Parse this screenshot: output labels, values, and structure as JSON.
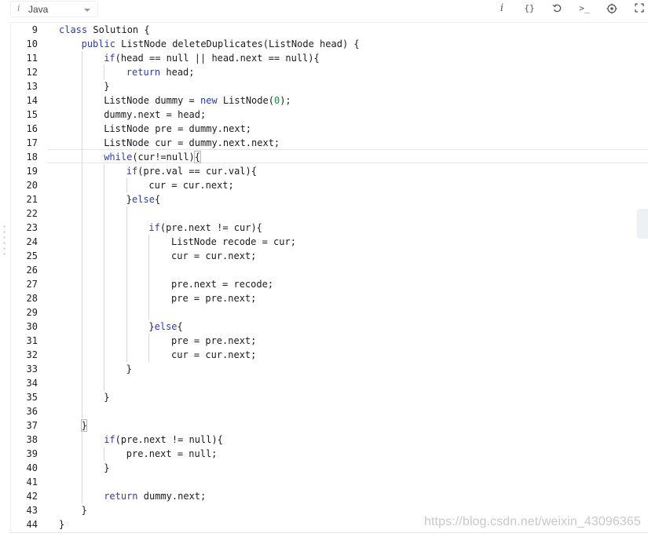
{
  "toolbar": {
    "language": "Java",
    "info_glyph": "i",
    "icons": [
      "info-icon",
      "braces-icon",
      "reset-icon",
      "console-icon",
      "settings-icon",
      "fullscreen-icon"
    ],
    "icon_glyphs": {
      "info": "i",
      "braces": "{}",
      "console": ">_"
    }
  },
  "editor": {
    "lines": [
      {
        "n": "9",
        "indent": 0,
        "segs": [
          [
            "kw",
            "class"
          ],
          [
            "t",
            " Solution {"
          ]
        ]
      },
      {
        "n": "10",
        "indent": 1,
        "segs": [
          [
            "kw",
            "public"
          ],
          [
            "t",
            " ListNode deleteDuplicates(ListNode head) {"
          ]
        ]
      },
      {
        "n": "11",
        "indent": 2,
        "segs": [
          [
            "kw",
            "if"
          ],
          [
            "t",
            "(head == null || head.next == null){"
          ]
        ]
      },
      {
        "n": "12",
        "indent": 3,
        "segs": [
          [
            "kw",
            "return"
          ],
          [
            "t",
            " head;"
          ]
        ]
      },
      {
        "n": "13",
        "indent": 2,
        "segs": [
          [
            "t",
            "}"
          ]
        ]
      },
      {
        "n": "14",
        "indent": 2,
        "segs": [
          [
            "t",
            "ListNode dummy = "
          ],
          [
            "kw",
            "new"
          ],
          [
            "t",
            " ListNode("
          ],
          [
            "num",
            "0"
          ],
          [
            "t",
            ");"
          ]
        ]
      },
      {
        "n": "15",
        "indent": 2,
        "segs": [
          [
            "t",
            "dummy.next = head;"
          ]
        ]
      },
      {
        "n": "16",
        "indent": 2,
        "segs": [
          [
            "t",
            "ListNode pre = dummy.next;"
          ]
        ]
      },
      {
        "n": "17",
        "indent": 2,
        "segs": [
          [
            "t",
            "ListNode cur = dummy.next.next;"
          ]
        ]
      },
      {
        "n": "18",
        "indent": 2,
        "segs": [
          [
            "kw",
            "while"
          ],
          [
            "t",
            "(cur!=null){"
          ]
        ]
      },
      {
        "n": "19",
        "indent": 3,
        "segs": [
          [
            "kw",
            "if"
          ],
          [
            "t",
            "(pre.val == cur.val){"
          ]
        ]
      },
      {
        "n": "20",
        "indent": 4,
        "segs": [
          [
            "t",
            "cur = cur.next;"
          ]
        ]
      },
      {
        "n": "21",
        "indent": 3,
        "segs": [
          [
            "t",
            "}"
          ],
          [
            "kw",
            "else"
          ],
          [
            "t",
            "{"
          ]
        ]
      },
      {
        "n": "22",
        "indent": 0,
        "segs": []
      },
      {
        "n": "23",
        "indent": 4,
        "segs": [
          [
            "kw",
            "if"
          ],
          [
            "t",
            "(pre.next != cur){"
          ]
        ]
      },
      {
        "n": "24",
        "indent": 5,
        "segs": [
          [
            "t",
            "ListNode recode = cur;"
          ]
        ]
      },
      {
        "n": "25",
        "indent": 5,
        "segs": [
          [
            "t",
            "cur = cur.next;"
          ]
        ]
      },
      {
        "n": "26",
        "indent": 0,
        "segs": []
      },
      {
        "n": "27",
        "indent": 5,
        "segs": [
          [
            "t",
            "pre.next = recode;"
          ]
        ]
      },
      {
        "n": "28",
        "indent": 5,
        "segs": [
          [
            "t",
            "pre = pre.next;"
          ]
        ]
      },
      {
        "n": "29",
        "indent": 0,
        "segs": []
      },
      {
        "n": "30",
        "indent": 4,
        "segs": [
          [
            "t",
            "}"
          ],
          [
            "kw",
            "else"
          ],
          [
            "t",
            "{"
          ]
        ]
      },
      {
        "n": "31",
        "indent": 5,
        "segs": [
          [
            "t",
            "pre = pre.next;"
          ]
        ]
      },
      {
        "n": "32",
        "indent": 5,
        "segs": [
          [
            "t",
            "cur = cur.next;"
          ]
        ]
      },
      {
        "n": "33",
        "indent": 3,
        "segs": [
          [
            "t",
            "}"
          ]
        ]
      },
      {
        "n": "34",
        "indent": 0,
        "segs": []
      },
      {
        "n": "35",
        "indent": 2,
        "segs": [
          [
            "t",
            "}"
          ]
        ]
      },
      {
        "n": "36",
        "indent": 0,
        "segs": []
      },
      {
        "n": "37",
        "indent": 1,
        "segs": [
          [
            "t",
            "}"
          ]
        ]
      },
      {
        "n": "38",
        "indent": 2,
        "segs": [
          [
            "kw",
            "if"
          ],
          [
            "t",
            "(pre.next != null){"
          ]
        ]
      },
      {
        "n": "39",
        "indent": 3,
        "segs": [
          [
            "t",
            "pre.next = null;"
          ]
        ]
      },
      {
        "n": "40",
        "indent": 2,
        "segs": [
          [
            "t",
            "}"
          ]
        ]
      },
      {
        "n": "41",
        "indent": 0,
        "segs": []
      },
      {
        "n": "42",
        "indent": 2,
        "segs": [
          [
            "kw",
            "return"
          ],
          [
            "t",
            " dummy.next;"
          ]
        ]
      },
      {
        "n": "43",
        "indent": 1,
        "segs": [
          [
            "t",
            "}"
          ]
        ]
      },
      {
        "n": "44",
        "indent": 0,
        "segs": [
          [
            "t",
            "}"
          ]
        ]
      }
    ]
  },
  "watermark": "https://blog.csdn.net/weixin_43096365"
}
